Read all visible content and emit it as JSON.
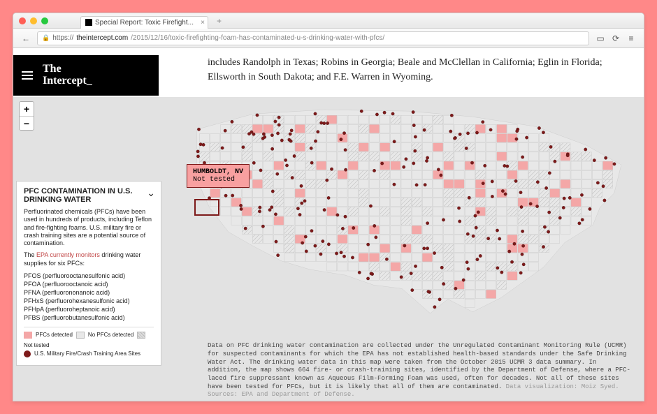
{
  "browser": {
    "tab_title": "Special Report: Toxic Firefight...",
    "url_host": "theintercept.com",
    "url_path": "/2015/12/16/toxic-firefighting-foam-has-contaminated-u-s-drinking-water-with-pfcs/",
    "back": "←",
    "forward": "→",
    "reload": "⟳",
    "menu": "≡",
    "plus": "+",
    "close": "×"
  },
  "masthead": {
    "logo_line1": "The",
    "logo_line2": "Intercept_"
  },
  "article": {
    "tail": "includes Randolph in Texas; Robins in Georgia; Beale and McClellan in California; Eglin in Florida; Ellsworth in South Dakota; and F.E. Warren in Wyoming."
  },
  "map": {
    "zoom_in": "+",
    "zoom_out": "−",
    "tooltip": {
      "title": "HUMBOLDT, NV",
      "sub": "Not tested"
    }
  },
  "panel": {
    "title": "PFC CONTAMINATION IN U.S. DRINKING WATER",
    "chevron": "⌄",
    "intro": "Perfluorinated chemicals (PFCs) have been used in hundreds of products, including Teflon and fire-fighting foams. U.S. military fire or crash training sites are a potential source of contamination.",
    "p2a": "The ",
    "p2link": "EPA currently monitors",
    "p2b": " drinking water supplies for six PFCs:",
    "pfc_list": [
      "PFOS (perfluorooctanesulfonic acid)",
      "PFOA (perfluorooctanoic acid)",
      "PFNA (perfluorononanoic acid)",
      "PFHxS (perfluorohexanesulfonic acid)",
      "PFHpA (perfluoroheptanoic acid)",
      "PFBS (perfluorobutanesulfonic acid)"
    ],
    "legend": {
      "detected": "PFCs detected",
      "no_detected": "No PFCs detected",
      "not_tested": "Not tested",
      "site": "U.S. Military Fire/Crash Training Area Sites"
    }
  },
  "caption": {
    "body": "Data on PFC drinking water contamination are collected under the Unregulated Contaminant Monitoring Rule (UCMR) for suspected contaminants for which the EPA has not established health-based standards under the Safe Drinking Water Act. The drinking water data in this map were taken from the October 2015 UCMR 3 data summary. In addition, the map shows 664 fire- or crash-training sites, identified by the Department of Defense, where a PFC-laced fire suppressant known as Aqueous Film-Forming Foam was used, often for decades. Not all of these sites have been tested for PFCs, but it is likely that all of them are contaminated. ",
    "credit": "Data visualization: Moiz Syed. Sources: EPA and Department of Defense."
  }
}
